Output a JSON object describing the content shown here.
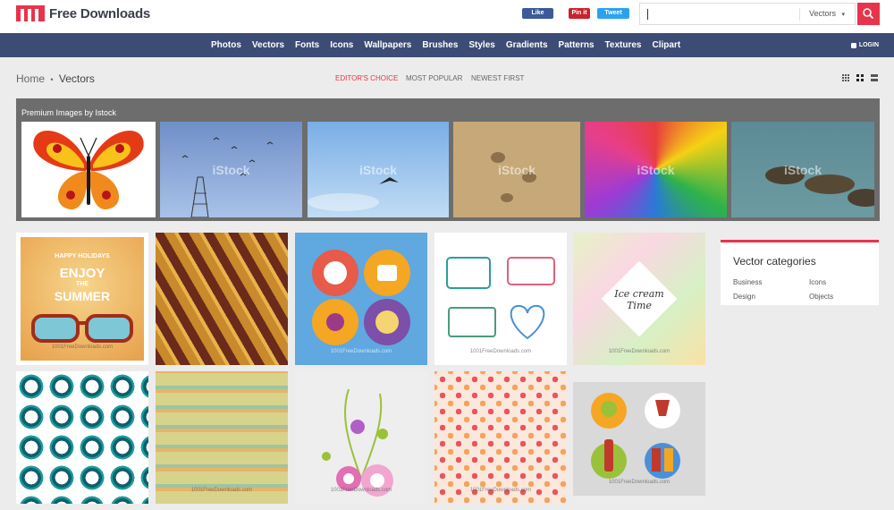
{
  "header": {
    "logo_text": "Free Downloads",
    "social": {
      "facebook": "Like",
      "pinterest": "Pin it",
      "twitter": "Tweet"
    },
    "search": {
      "value": "",
      "category": "Vectors",
      "category_caret": "▾"
    }
  },
  "nav": {
    "items": [
      "Photos",
      "Vectors",
      "Fonts",
      "Icons",
      "Wallpapers",
      "Brushes",
      "Styles",
      "Gradients",
      "Patterns",
      "Textures",
      "Clipart"
    ],
    "login": "LOGIN"
  },
  "breadcrumb": {
    "home": "Home",
    "separator": "•",
    "current": "Vectors"
  },
  "sort": {
    "editors_choice": "EDITOR'S CHOICE",
    "most_popular": "MOST POPULAR",
    "newest_first": "NEWEST FIRST"
  },
  "premium": {
    "title": "Premium Images by Istock",
    "watermark": "iStock"
  },
  "grid": {
    "summer_top": "HAPPY HOLIDAYS",
    "summer_main": "ENJOY",
    "summer_the": "THE",
    "summer_word": "SUMMER",
    "icecream_text": "Ice cream Time",
    "watermark": "1001FreeDownloads.com"
  },
  "sidebar": {
    "title": "Vector categories",
    "links": [
      "Business",
      "Icons",
      "Design",
      "Objects"
    ]
  },
  "colors": {
    "accent": "#e8344a",
    "nav_bg": "#3c4c75",
    "premium_bg": "#6d6d6d"
  }
}
